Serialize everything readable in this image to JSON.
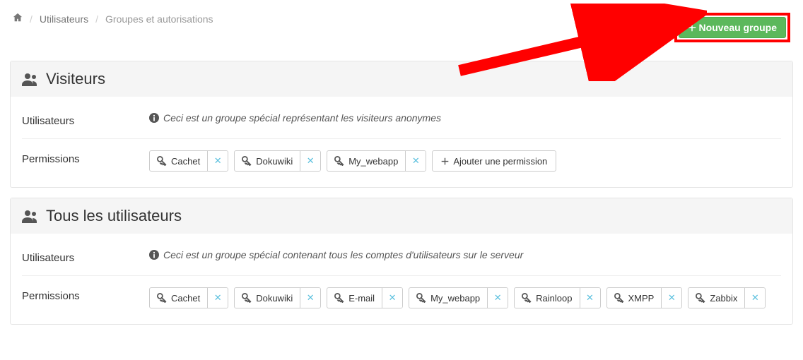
{
  "breadcrumb": {
    "item1": "Utilisateurs",
    "item2": "Groupes et autorisations"
  },
  "new_group_button": "Nouveau groupe",
  "add_permission_label": "Ajouter une permission",
  "labels": {
    "users": "Utilisateurs",
    "permissions": "Permissions"
  },
  "groups": [
    {
      "title": "Visiteurs",
      "description": "Ceci est un groupe spécial représentant les visiteurs anonymes",
      "permissions": [
        "Cachet",
        "Dokuwiki",
        "My_webapp"
      ]
    },
    {
      "title": "Tous les utilisateurs",
      "description": "Ceci est un groupe spécial contenant tous les comptes d'utilisateurs sur le serveur",
      "permissions": [
        "Cachet",
        "Dokuwiki",
        "E-mail",
        "My_webapp",
        "Rainloop",
        "XMPP",
        "Zabbix"
      ]
    }
  ]
}
